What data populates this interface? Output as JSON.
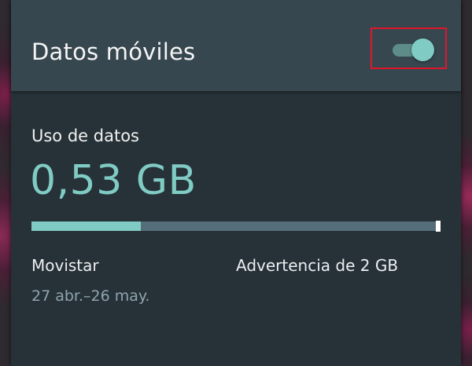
{
  "header": {
    "title": "Datos móviles",
    "toggle": {
      "state": "on",
      "accent_color": "#80cbc4",
      "highlight_color": "#e0162b"
    }
  },
  "usage": {
    "label": "Uso de datos",
    "value": "0,53 GB",
    "progress_fraction": 0.27,
    "carrier": "Movistar",
    "warning": "Advertencia de 2 GB",
    "period": "27 abr.–26 may."
  },
  "colors": {
    "panel_background": "#263238",
    "header_background": "#37474f",
    "accent": "#80cbc4",
    "bar_track": "#546e7a"
  }
}
